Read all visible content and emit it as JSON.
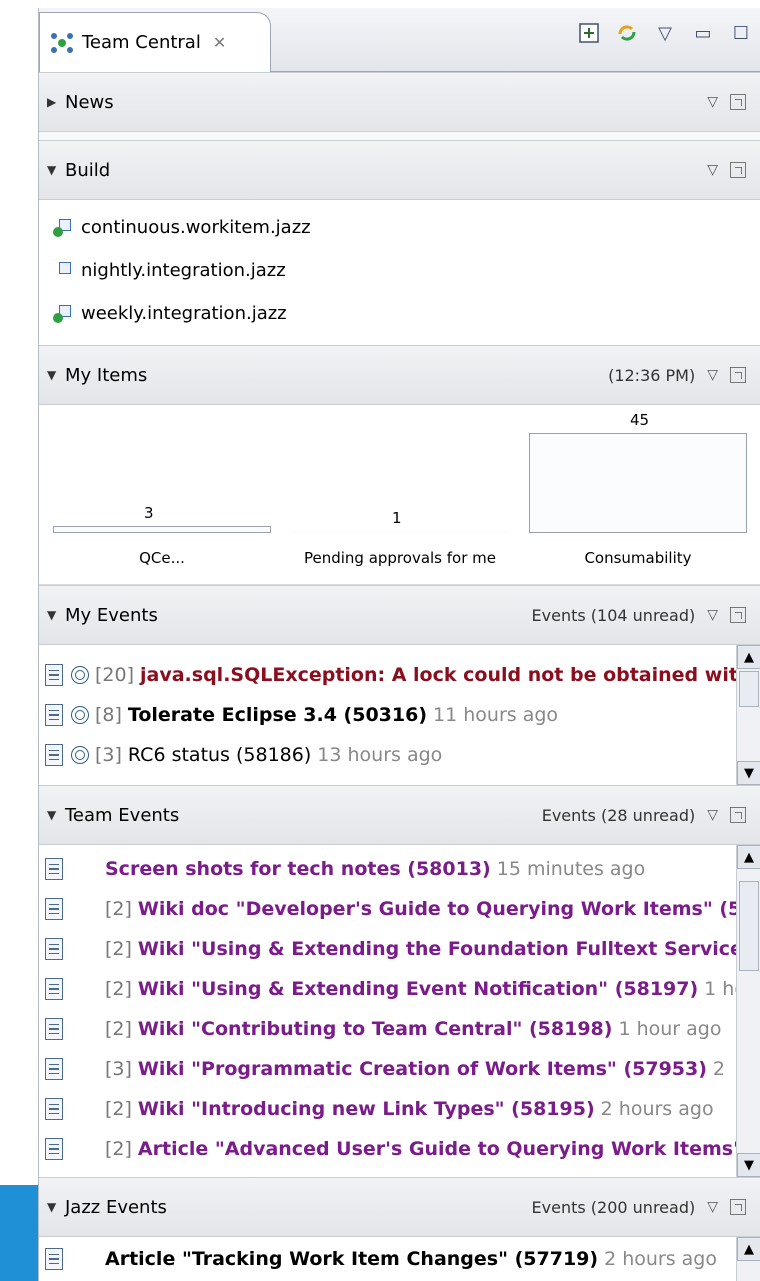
{
  "tab": {
    "title": "Team Central",
    "close_icon": "close-icon"
  },
  "sections": {
    "news": {
      "title": "News"
    },
    "build": {
      "title": "Build",
      "items": [
        {
          "label": "continuous.workitem.jazz",
          "icon": "build-ok-icon"
        },
        {
          "label": "nightly.integration.jazz",
          "icon": "build-icon"
        },
        {
          "label": "weekly.integration.jazz",
          "icon": "build-ok-icon"
        }
      ]
    },
    "my_items": {
      "title": "My Items",
      "time": "(12:36 PM)"
    },
    "my_events": {
      "title": "My Events",
      "status": "Events (104 unread)"
    },
    "team_events": {
      "title": "Team Events",
      "status": "Events (28 unread)"
    },
    "jazz_events": {
      "title": "Jazz Events",
      "status": "Events (200 unread)"
    }
  },
  "chart_data": {
    "type": "bar",
    "categories": [
      "QCe...",
      "Pending approvals for me",
      "Consumability"
    ],
    "values": [
      3,
      1,
      45
    ],
    "title": "",
    "xlabel": "",
    "ylabel": ""
  },
  "my_events": [
    {
      "count": "[20]",
      "text": "java.sql.SQLException: A lock could not be obtained witt",
      "time": ""
    },
    {
      "count": "[8]",
      "text": "Tolerate Eclipse 3.4 (50316)",
      "time": "11 hours ago"
    },
    {
      "count": "[3]",
      "text": "RC6 status (58186)",
      "time": "13 hours ago"
    }
  ],
  "team_events": [
    {
      "count": "",
      "text": "Screen shots for tech notes (58013)",
      "time": "15 minutes ago"
    },
    {
      "count": "[2]",
      "text": "Wiki doc \"Developer's Guide to Querying Work Items\" (5",
      "time": ""
    },
    {
      "count": "[2]",
      "text": "Wiki \"Using & Extending the Foundation Fulltext Service\"",
      "time": ""
    },
    {
      "count": "[2]",
      "text": "Wiki \"Using & Extending Event Notification\" (58197)",
      "time": "1 hc"
    },
    {
      "count": "[2]",
      "text": "Wiki \"Contributing to Team Central\" (58198)",
      "time": "1 hour ago"
    },
    {
      "count": "[3]",
      "text": "Wiki \"Programmatic Creation of Work Items\" (57953)",
      "time": "2"
    },
    {
      "count": "[2]",
      "text": "Wiki \"Introducing new Link Types\" (58195)",
      "time": "2 hours ago"
    },
    {
      "count": "[2]",
      "text": "Article \"Advanced User's Guide to Querying Work Items\"",
      "time": ""
    }
  ],
  "jazz_events": [
    {
      "count": "",
      "text": "Article \"Tracking Work Item Changes\" (57719)",
      "time": "2 hours ago"
    }
  ]
}
